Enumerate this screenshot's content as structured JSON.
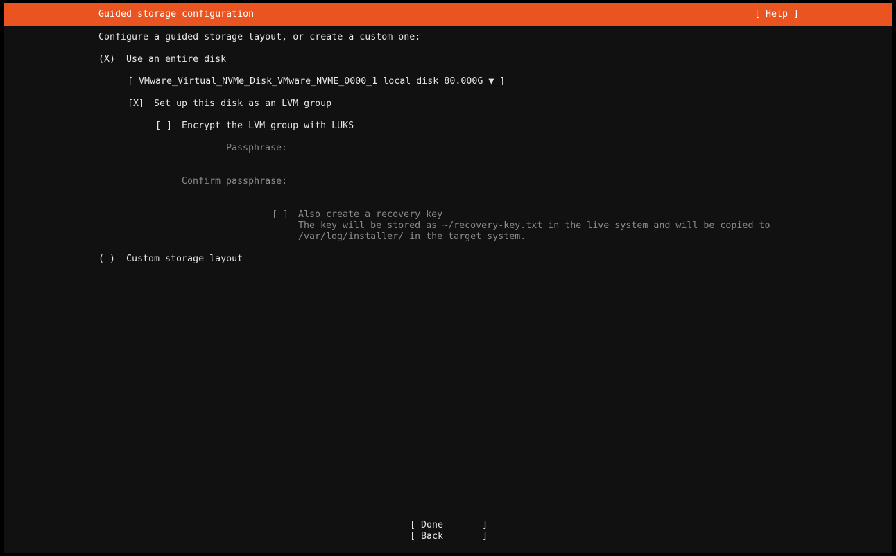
{
  "header": {
    "title": "Guided storage configuration",
    "help_label": "[ Help ]"
  },
  "intro": "Configure a guided storage layout, or create a custom one:",
  "options": {
    "entire_disk": {
      "marker": "(X)",
      "label": "Use an entire disk"
    },
    "disk_select": {
      "value": "[ VMware_Virtual_NVMe_Disk_VMware_NVME_0000_1 local disk 80.000G ▼ ]"
    },
    "lvm": {
      "marker": "[X]",
      "label": "Set up this disk as an LVM group"
    },
    "encrypt": {
      "marker": "[ ]",
      "label": "Encrypt the LVM group with LUKS"
    },
    "passphrase": {
      "label": "Passphrase:",
      "value": ""
    },
    "confirm_passphrase": {
      "label": "Confirm passphrase:",
      "value": ""
    },
    "recovery_key": {
      "marker": "[ ]",
      "label": "Also create a recovery key",
      "help_line1": "The key will be stored as ~/recovery-key.txt in the live system and will be copied to",
      "help_line2": "/var/log/installer/ in the target system."
    },
    "custom": {
      "marker": "( )",
      "label": "Custom storage layout"
    }
  },
  "buttons": {
    "done": "[ Done       ]",
    "back": "[ Back       ]"
  },
  "colors": {
    "header_bg": "#e95420",
    "screen_bg": "#111111",
    "text": "#e6e6e6",
    "disabled_text": "#8a8a8a"
  }
}
